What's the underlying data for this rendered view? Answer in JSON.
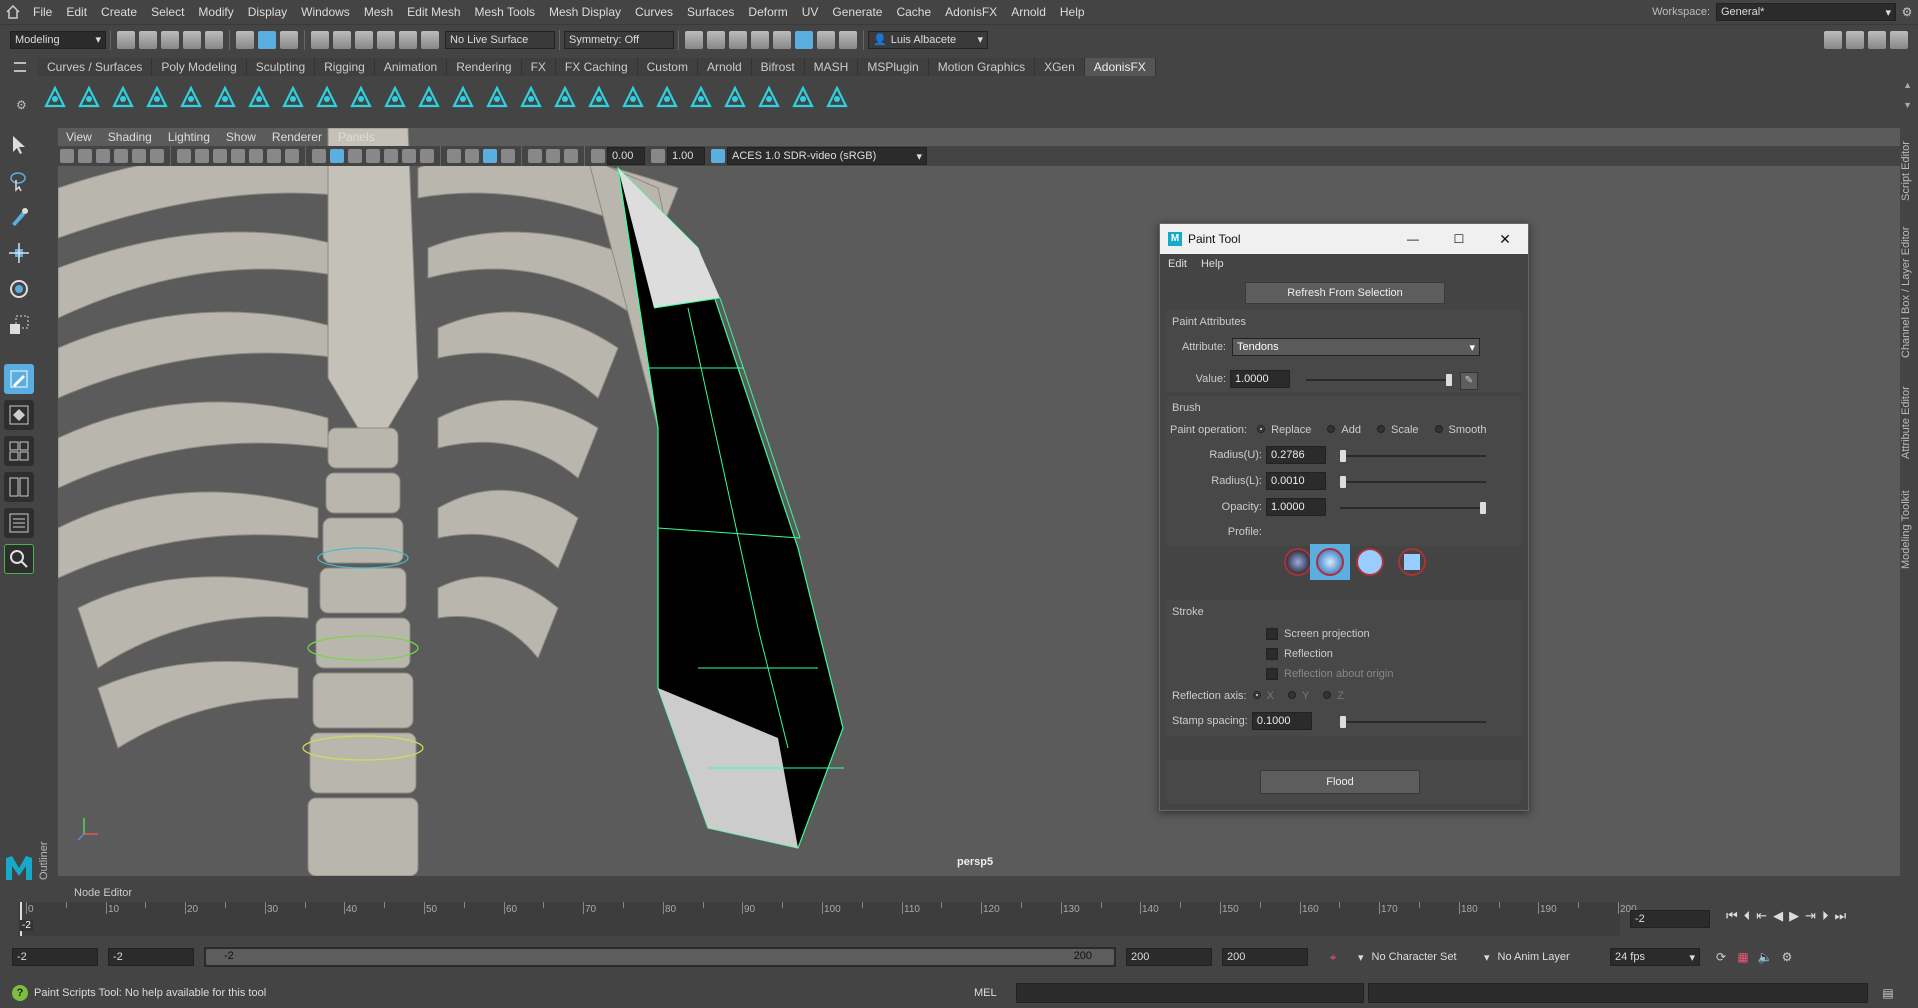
{
  "menubar": {
    "items": [
      "File",
      "Edit",
      "Create",
      "Select",
      "Modify",
      "Display",
      "Windows",
      "Mesh",
      "Edit Mesh",
      "Mesh Tools",
      "Mesh Display",
      "Curves",
      "Surfaces",
      "Deform",
      "UV",
      "Generate",
      "Cache",
      "AdonisFX",
      "Arnold",
      "Help"
    ],
    "workspace_label": "Workspace:",
    "workspace_value": "General*"
  },
  "statusline": {
    "mode": "Modeling",
    "live_surface": "No Live Surface",
    "symmetry": "Symmetry: Off",
    "user": "Luis Albacete"
  },
  "shelf": {
    "tabs": [
      "Curves / Surfaces",
      "Poly Modeling",
      "Sculpting",
      "Rigging",
      "Animation",
      "Rendering",
      "FX",
      "FX Caching",
      "Custom",
      "Arnold",
      "Bifrost",
      "MASH",
      "MSPlugin",
      "Motion Graphics",
      "XGen",
      "AdonisFX"
    ],
    "active_tab": "AdonisFX"
  },
  "viewport": {
    "menu": [
      "View",
      "Shading",
      "Lighting",
      "Show",
      "Renderer",
      "Panels"
    ],
    "exposure": "0.00",
    "gamma": "1.00",
    "color_space": "ACES 1.0 SDR-video (sRGB)",
    "camera_label": "persp5",
    "outliner_tab": "Outliner",
    "right_tabs": [
      "Script Editor",
      "Channel Box / Layer Editor",
      "Attribute Editor",
      "Modeling Toolkit"
    ]
  },
  "paint_tool": {
    "title": "Paint Tool",
    "menu": [
      "Edit",
      "Help"
    ],
    "refresh_button": "Refresh From Selection",
    "paint_attributes": {
      "header": "Paint Attributes",
      "attribute_label": "Attribute:",
      "attribute_value": "Tendons",
      "value_label": "Value:",
      "value": "1.0000",
      "value_fraction": 1.0
    },
    "brush": {
      "header": "Brush",
      "paint_operation_label": "Paint operation:",
      "operations": [
        "Replace",
        "Add",
        "Scale",
        "Smooth"
      ],
      "selected_operation": "Replace",
      "radius_u_label": "Radius(U):",
      "radius_u": "0.2786",
      "radius_l_label": "Radius(L):",
      "radius_l": "0.0010",
      "opacity_label": "Opacity:",
      "opacity": "1.0000",
      "profile_label": "Profile:"
    },
    "stroke": {
      "header": "Stroke",
      "screen_projection": "Screen projection",
      "reflection": "Reflection",
      "reflection_about_origin": "Reflection about origin",
      "reflection_axis_label": "Reflection axis:",
      "axes": [
        "X",
        "Y",
        "Z"
      ],
      "stamp_spacing_label": "Stamp spacing:",
      "stamp_spacing": "0.1000"
    },
    "flood_button": "Flood"
  },
  "bottom": {
    "node_editor": "Node Editor",
    "timeline_ticks": [
      "0",
      "10",
      "20",
      "30",
      "40",
      "50",
      "60",
      "70",
      "80",
      "90",
      "100",
      "110",
      "120",
      "130",
      "140",
      "150",
      "160",
      "170",
      "180",
      "190",
      "200"
    ],
    "current_frame_marker": "-2",
    "current_frame": "-2",
    "range_start": "-2",
    "range_inner_start": "-2",
    "range_slider_start": "-2",
    "range_slider_end": "200",
    "range_inner_end": "200",
    "range_end": "200",
    "character_set": "No Character Set",
    "anim_layer": "No Anim Layer",
    "fps": "24 fps",
    "help_text": "Paint Scripts Tool: No help available for this tool",
    "command_lang": "MEL"
  },
  "colors": {
    "accent": "#5aaee0",
    "wire": "#33ff99",
    "bg": "#444444"
  }
}
